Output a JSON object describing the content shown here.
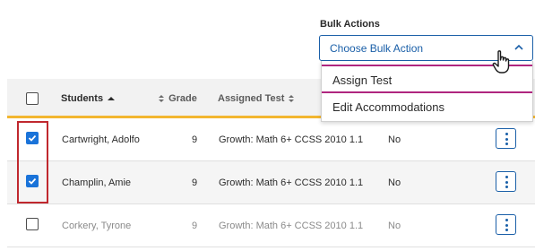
{
  "bulk_actions": {
    "label": "Bulk Actions",
    "selected": "Choose Bulk Action",
    "options": [
      "Assign Test",
      "Edit Accommodations"
    ]
  },
  "table": {
    "headers": {
      "students": "Students",
      "grade": "Grade",
      "assigned_test": "Assigned Test"
    },
    "rows": [
      {
        "name": "Cartwright, Adolfo",
        "grade": "9",
        "test": "Growth: Math 6+ CCSS 2010 1.1",
        "status": "No",
        "checked": true
      },
      {
        "name": "Champlin, Amie",
        "grade": "9",
        "test": "Growth: Math 6+ CCSS 2010 1.1",
        "status": "No",
        "checked": true
      },
      {
        "name": "Corkery, Tyrone",
        "grade": "9",
        "test": "Growth: Math 6+ CCSS 2010 1.1",
        "status": "No",
        "checked": false
      }
    ]
  },
  "colors": {
    "accent": "#1a5fa8",
    "header_underline": "#f2b630",
    "menu_highlight": "#b0267f",
    "selection_box": "#c0282e"
  }
}
